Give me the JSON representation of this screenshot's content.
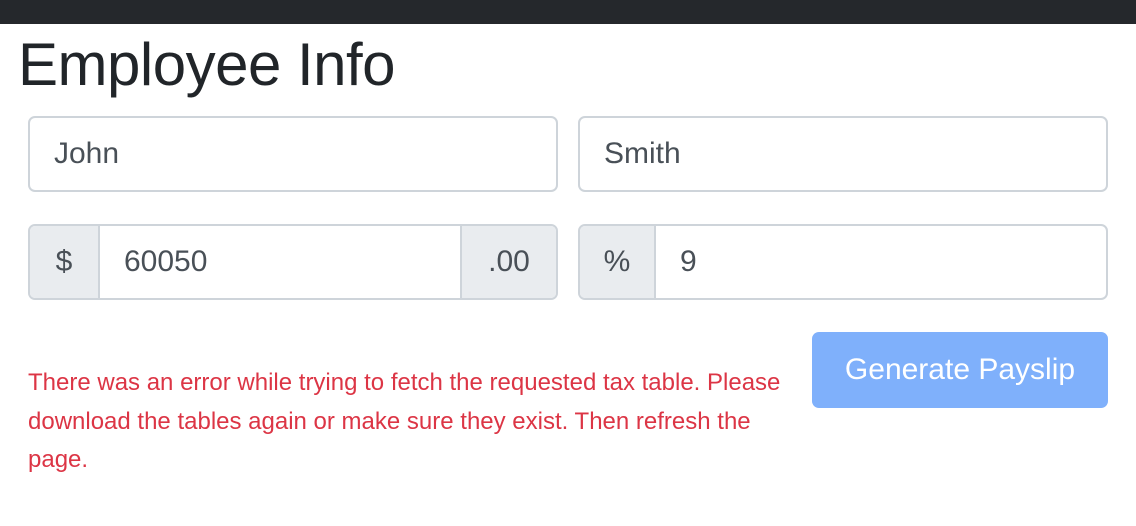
{
  "page": {
    "title": "Employee Info"
  },
  "form": {
    "first_name": {
      "value": "John"
    },
    "last_name": {
      "value": "Smith"
    },
    "salary": {
      "prefix": "$",
      "value": "60050",
      "suffix": ".00"
    },
    "super_rate": {
      "prefix": "%",
      "value": "9"
    }
  },
  "error": {
    "message": "There was an error while trying to fetch the requested tax table. Please download the tables again or make sure they exist. Then refresh the page."
  },
  "actions": {
    "generate_label": "Generate Payslip",
    "generate_color": "#7fb0fb"
  },
  "colors": {
    "topbar": "#25282c",
    "error": "#dc3545"
  }
}
